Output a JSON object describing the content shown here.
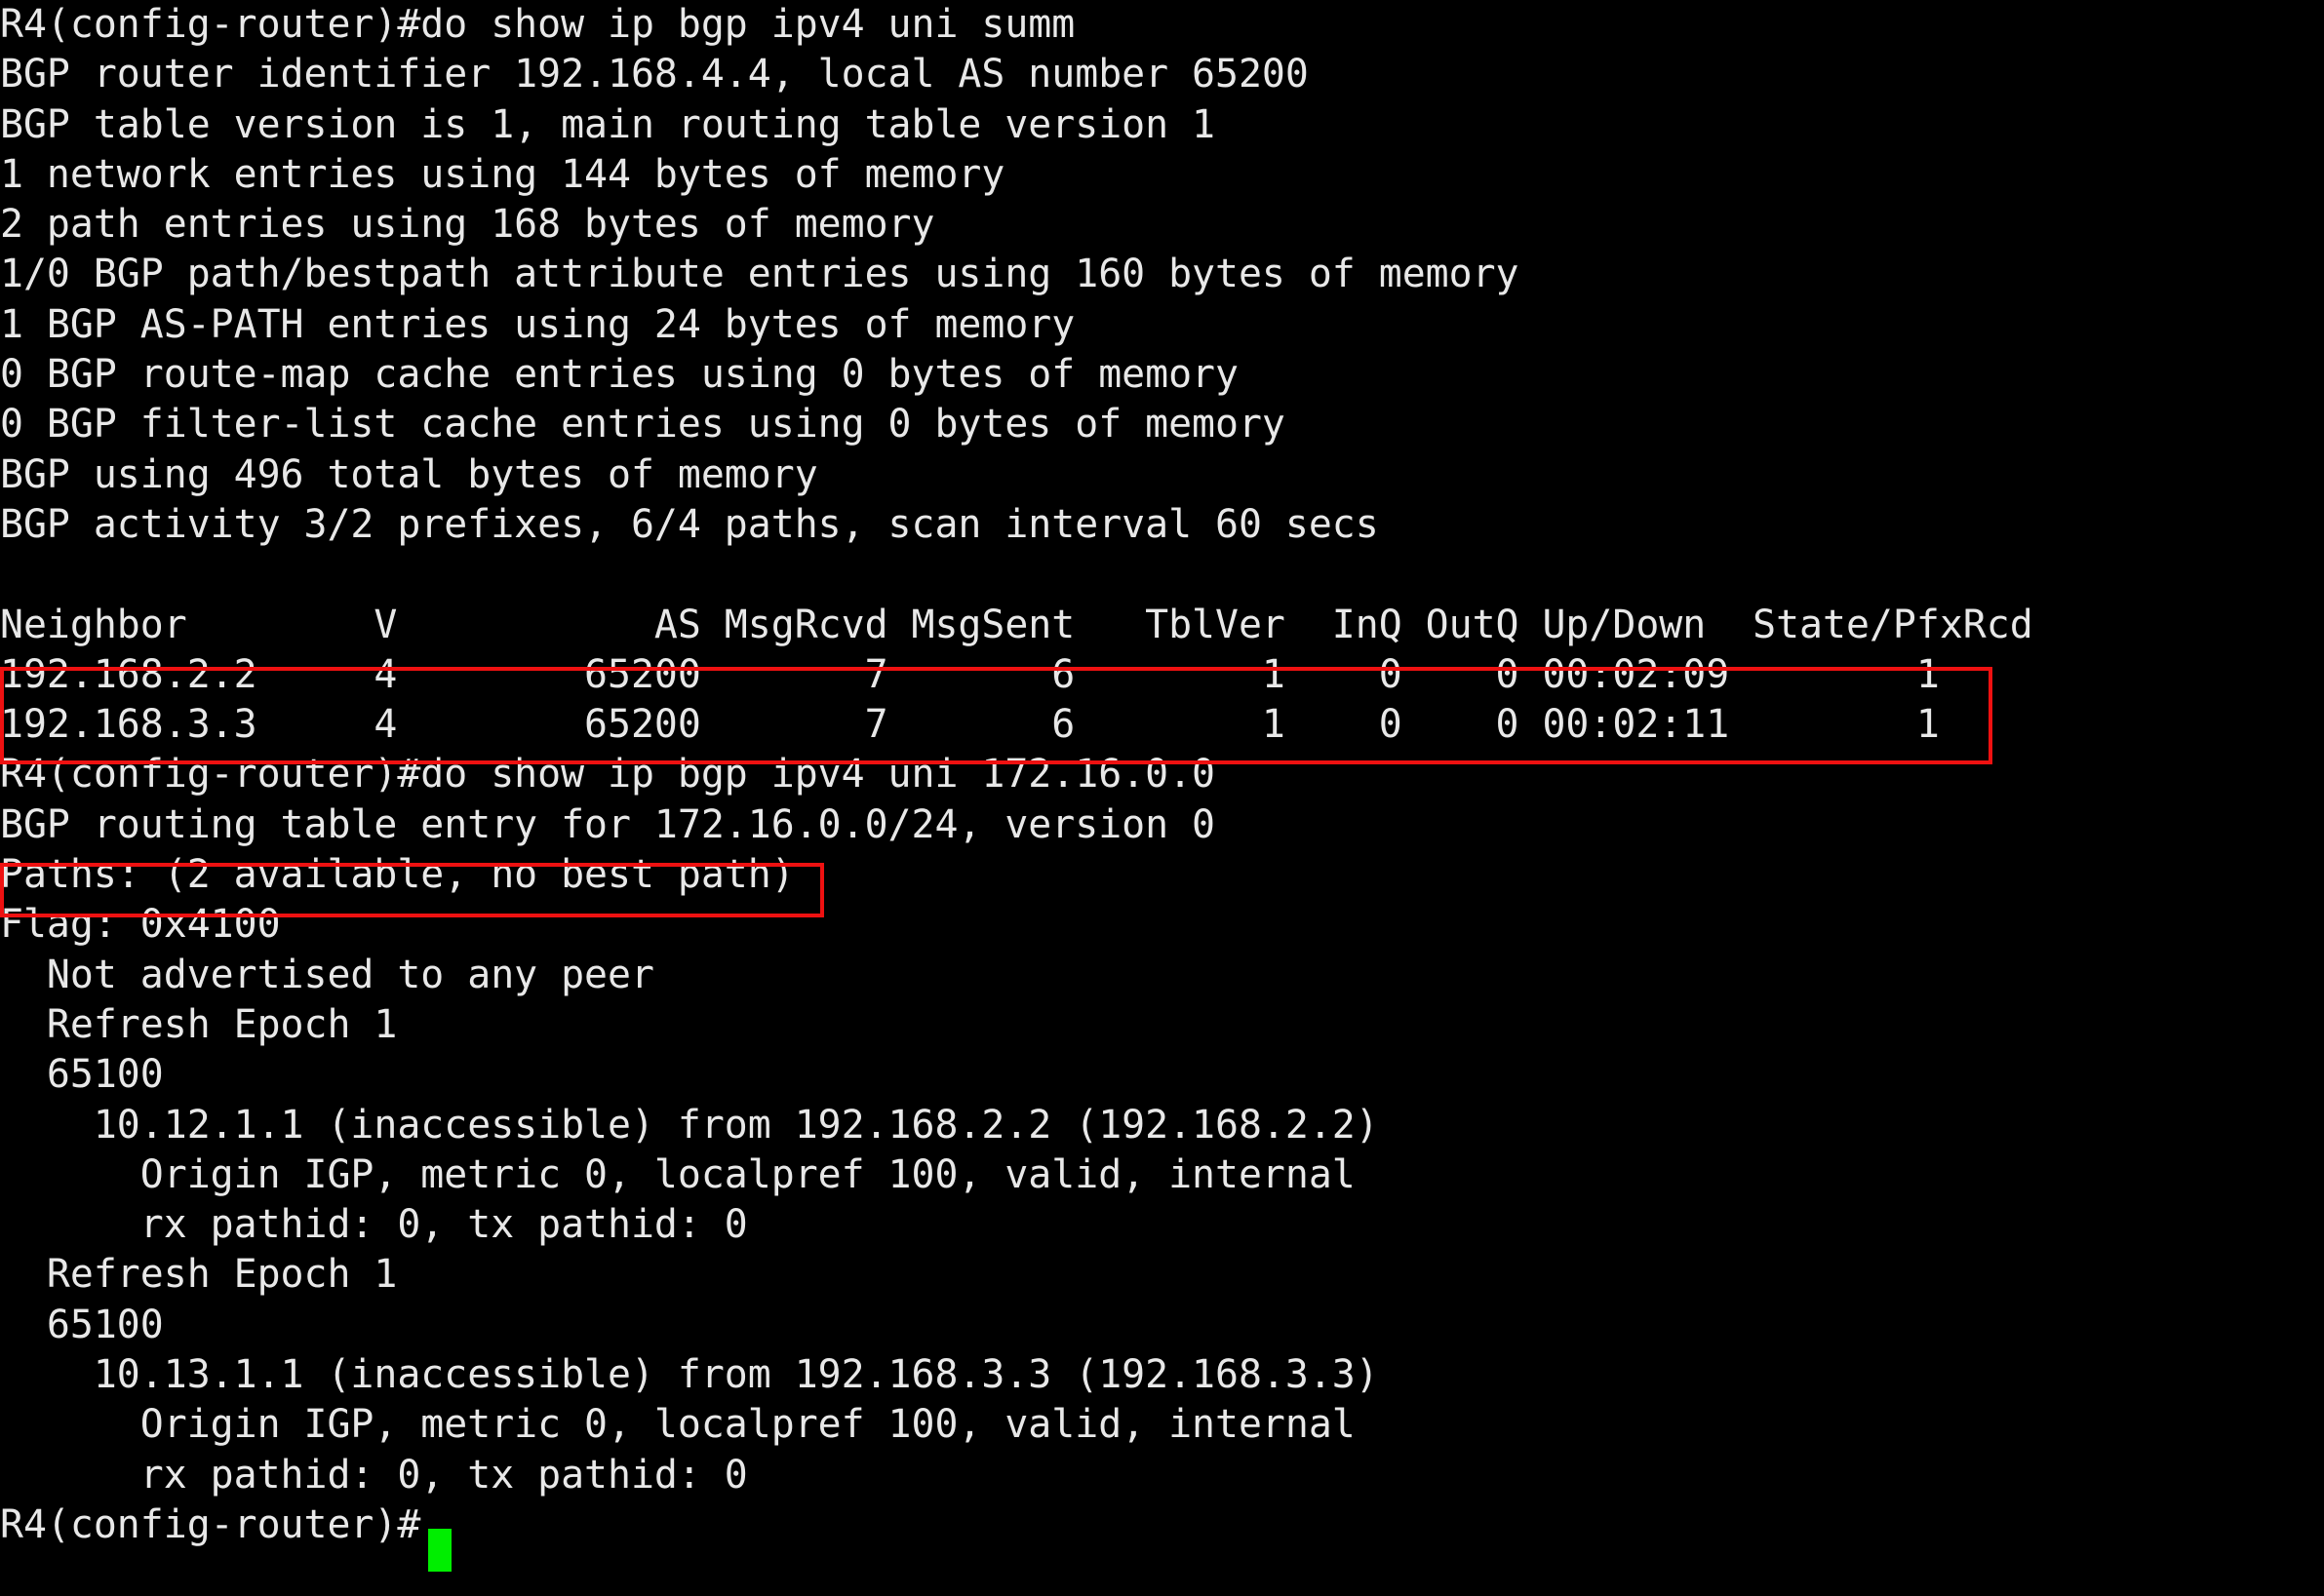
{
  "terminal": {
    "background_color": "#000000",
    "foreground_color": "#e8e8e8",
    "cursor_color": "#00ee00",
    "highlight_color": "#ee1111",
    "hostname_prompt": "R4(config-router)#",
    "lines": [
      "R4(config-router)#do show ip bgp ipv4 uni summ",
      "BGP router identifier 192.168.4.4, local AS number 65200",
      "BGP table version is 1, main routing table version 1",
      "1 network entries using 144 bytes of memory",
      "2 path entries using 168 bytes of memory",
      "1/0 BGP path/bestpath attribute entries using 160 bytes of memory",
      "1 BGP AS-PATH entries using 24 bytes of memory",
      "0 BGP route-map cache entries using 0 bytes of memory",
      "0 BGP filter-list cache entries using 0 bytes of memory",
      "BGP using 496 total bytes of memory",
      "BGP activity 3/2 prefixes, 6/4 paths, scan interval 60 secs",
      "",
      "Neighbor        V           AS MsgRcvd MsgSent   TblVer  InQ OutQ Up/Down  State/PfxRcd",
      "192.168.2.2     4        65200       7       6        1    0    0 00:02:09        1",
      "192.168.3.3     4        65200       7       6        1    0    0 00:02:11        1",
      "R4(config-router)#do show ip bgp ipv4 uni 172.16.0.0",
      "BGP routing table entry for 172.16.0.0/24, version 0",
      "Paths: (2 available, no best path)",
      "Flag: 0x4100",
      "  Not advertised to any peer",
      "  Refresh Epoch 1",
      "  65100",
      "    10.12.1.1 (inaccessible) from 192.168.2.2 (192.168.2.2)",
      "      Origin IGP, metric 0, localpref 100, valid, internal",
      "      rx pathid: 0, tx pathid: 0",
      "  Refresh Epoch 1",
      "  65100",
      "    10.13.1.1 (inaccessible) from 192.168.3.3 (192.168.3.3)",
      "      Origin IGP, metric 0, localpref 100, valid, internal",
      "      rx pathid: 0, tx pathid: 0",
      "R4(config-router)#"
    ],
    "commands": {
      "command_1": "do show ip bgp ipv4 uni summ",
      "command_2": "do show ip bgp ipv4 uni 172.16.0.0"
    },
    "bgp_summary": {
      "router_identifier": "192.168.4.4",
      "local_as_number": "65200",
      "table_version": "1",
      "main_routing_table_version": "1",
      "network_entries": "1",
      "network_entries_bytes": "144",
      "path_entries": "2",
      "path_entries_bytes": "168",
      "path_bestpath_attribute_entries": "1/0",
      "path_bestpath_attribute_bytes": "160",
      "as_path_entries": "1",
      "as_path_bytes": "24",
      "route_map_cache_entries": "0",
      "route_map_cache_bytes": "0",
      "filter_list_cache_entries": "0",
      "filter_list_cache_bytes": "0",
      "total_bytes": "496",
      "activity_prefixes": "3/2",
      "activity_paths": "6/4",
      "scan_interval_secs": "60"
    },
    "neighbor_table": {
      "columns": [
        "Neighbor",
        "V",
        "AS",
        "MsgRcvd",
        "MsgSent",
        "TblVer",
        "InQ",
        "OutQ",
        "Up/Down",
        "State/PfxRcd"
      ],
      "rows": [
        {
          "neighbor": "192.168.2.2",
          "v": "4",
          "as": "65200",
          "msg_rcvd": "7",
          "msg_sent": "6",
          "tbl_ver": "1",
          "in_q": "0",
          "out_q": "0",
          "up_down": "00:02:09",
          "state_pfx_rcd": "1"
        },
        {
          "neighbor": "192.168.3.3",
          "v": "4",
          "as": "65200",
          "msg_rcvd": "7",
          "msg_sent": "6",
          "tbl_ver": "1",
          "in_q": "0",
          "out_q": "0",
          "up_down": "00:02:11",
          "state_pfx_rcd": "1"
        }
      ]
    },
    "bgp_route_detail": {
      "prefix": "172.16.0.0/24",
      "version": "0",
      "paths_line": "Paths: (2 available, no best path)",
      "flag": "0x4100",
      "advertised": "Not advertised to any peer",
      "paths": [
        {
          "refresh_epoch": "1",
          "as_path": "65100",
          "nexthop": "10.12.1.1",
          "nexthop_state": "inaccessible",
          "from": "192.168.2.2",
          "router_id": "192.168.2.2",
          "origin": "IGP",
          "metric": "0",
          "localpref": "100",
          "attributes": "valid, internal",
          "rx_pathid": "0",
          "tx_pathid": "0"
        },
        {
          "refresh_epoch": "1",
          "as_path": "65100",
          "nexthop": "10.13.1.1",
          "nexthop_state": "inaccessible",
          "from": "192.168.3.3",
          "router_id": "192.168.3.3",
          "origin": "IGP",
          "metric": "0",
          "localpref": "100",
          "attributes": "valid, internal",
          "rx_pathid": "0",
          "tx_pathid": "0"
        }
      ]
    },
    "annotations": [
      {
        "name": "neighbors-highlight",
        "description": "red rectangle around the two BGP neighbor rows"
      },
      {
        "name": "paths-highlight",
        "description": "red rectangle around the Paths: (2 available, no best path) line"
      }
    ]
  }
}
